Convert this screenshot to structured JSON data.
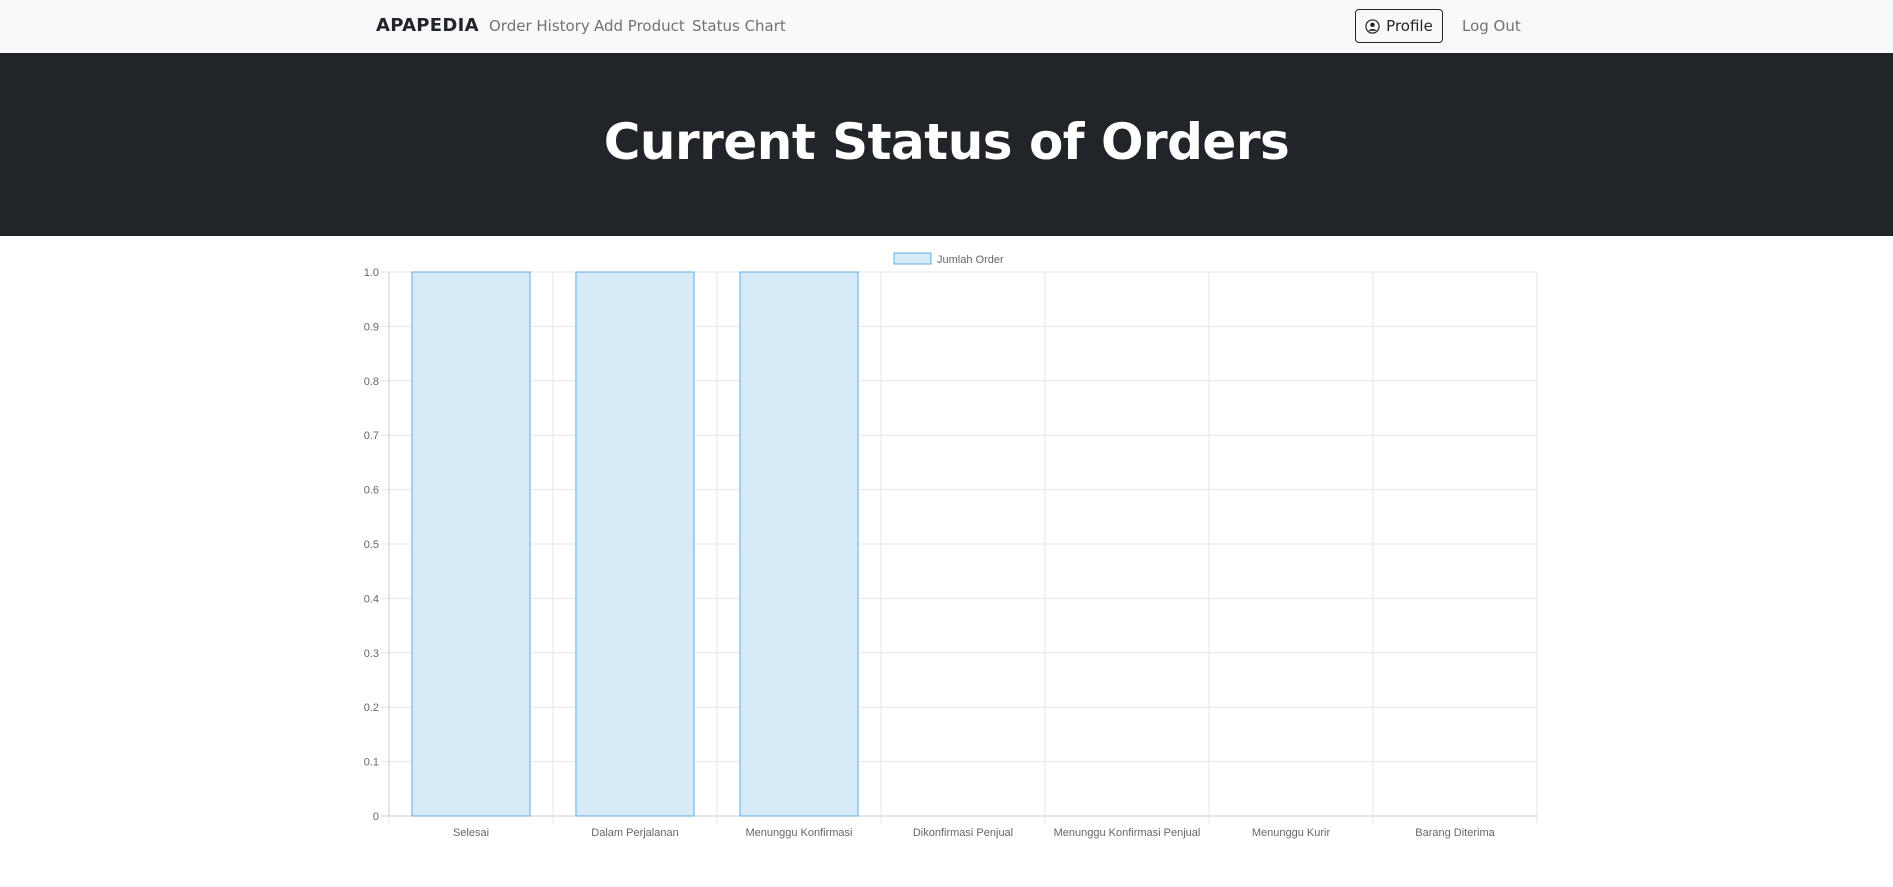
{
  "navbar": {
    "brand": "APAPEDIA",
    "links": [
      "Order History",
      "Add Product",
      "Status Chart"
    ],
    "profile_label": "Profile",
    "logout_label": "Log Out"
  },
  "hero": {
    "title": "Current Status of Orders"
  },
  "colors": {
    "bar_fill": "#d6eaf8",
    "bar_stroke": "#5dade2",
    "grid": "#e6e6e6",
    "tick_text": "#666666",
    "hero_bg": "#212529",
    "navbar_bg": "#f8f9fa"
  },
  "chart_data": {
    "type": "bar",
    "legend_position": "top",
    "series": [
      {
        "name": "Jumlah Order",
        "values": [
          1,
          1,
          1,
          0,
          0,
          0,
          0
        ]
      }
    ],
    "categories": [
      "Selesai",
      "Dalam Perjalanan",
      "Menunggu Konfirmasi",
      "Dikonfirmasi Penjual",
      "Menunggu Konfirmasi Penjual",
      "Menunggu Kurir",
      "Barang Diterima"
    ],
    "ylim": [
      0,
      1.0
    ],
    "yticks": [
      "0",
      "0.1",
      "0.2",
      "0.3",
      "0.4",
      "0.5",
      "0.6",
      "0.7",
      "0.8",
      "0.9",
      "1.0"
    ],
    "grid": true
  }
}
